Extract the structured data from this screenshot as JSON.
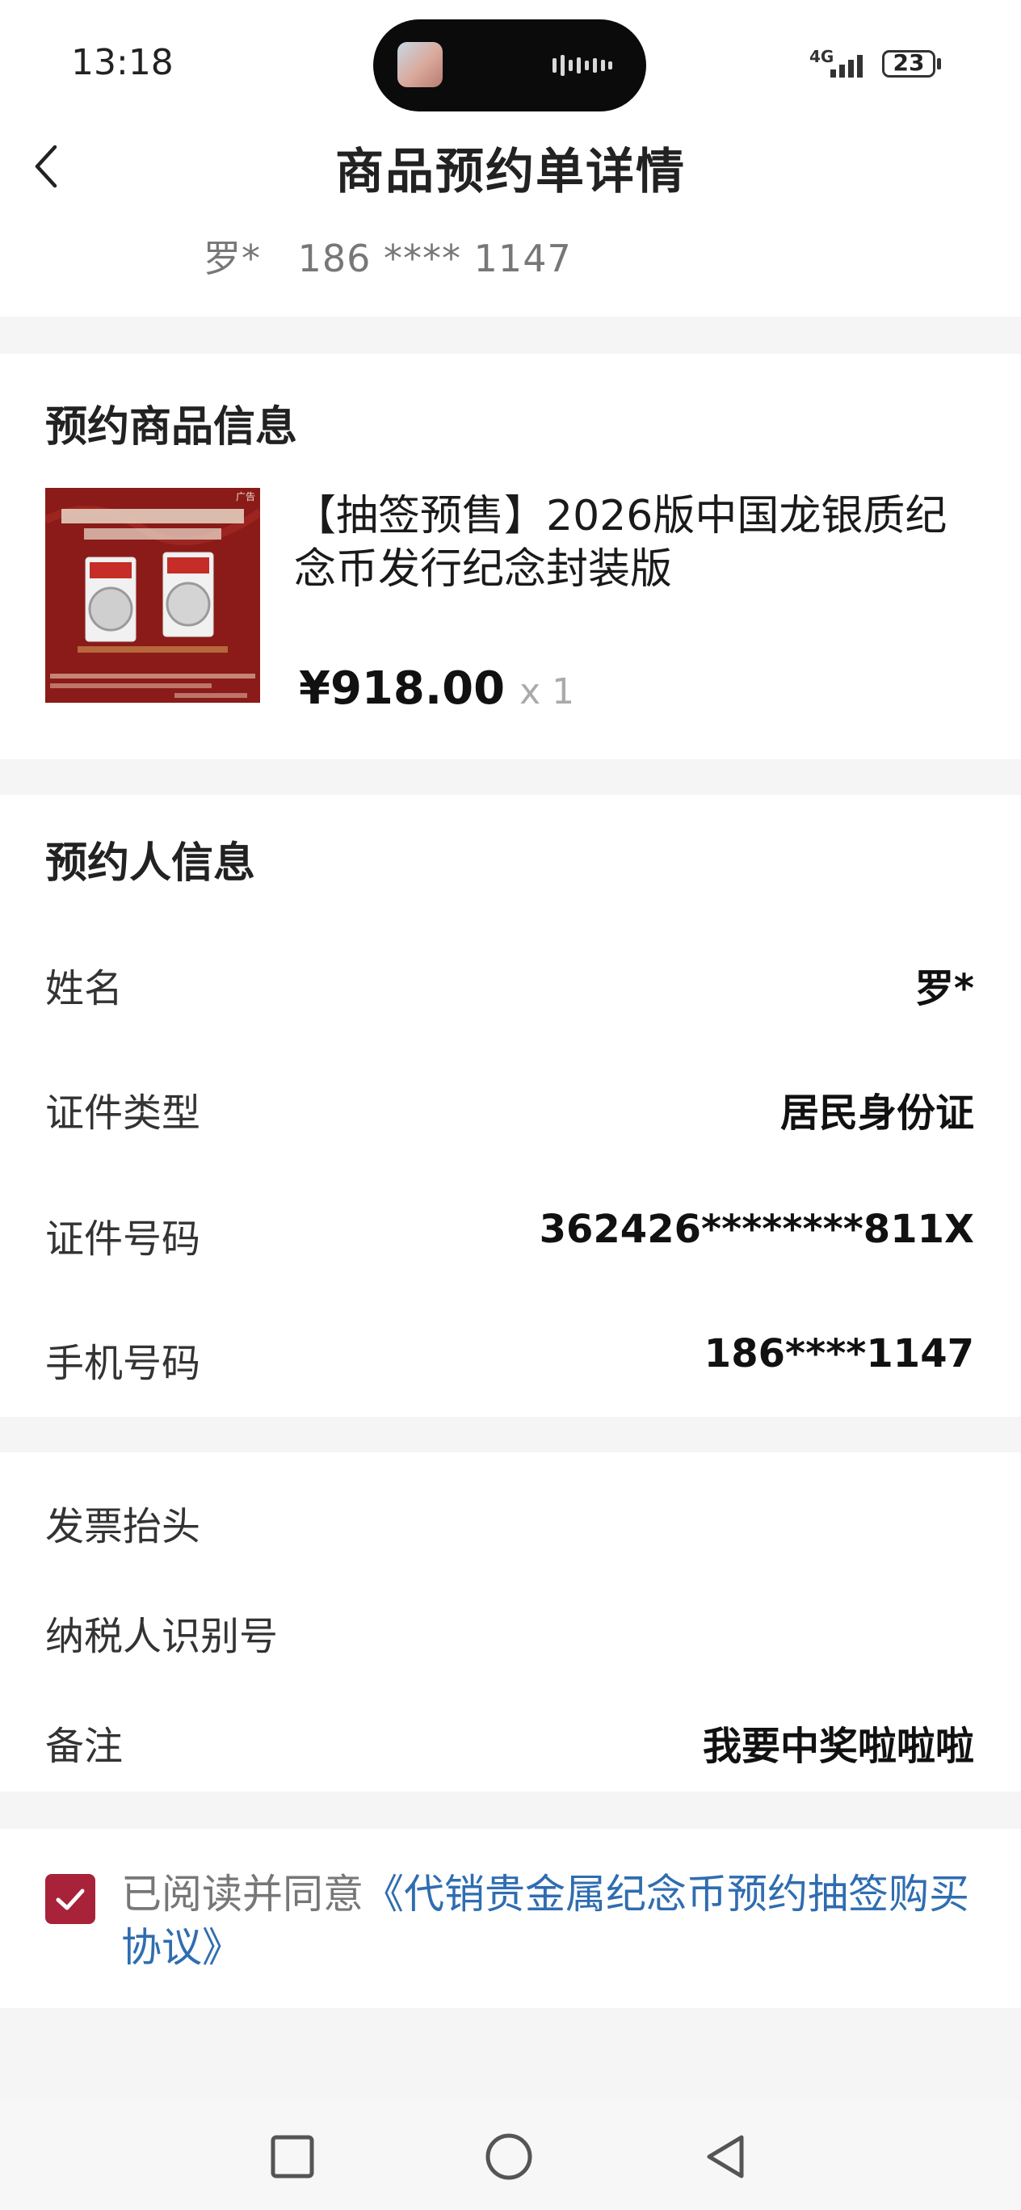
{
  "status_bar": {
    "time": "13:18",
    "network": "4G",
    "battery": "23"
  },
  "header": {
    "title": "商品预约单详情",
    "contact_name": "罗*",
    "contact_phone": "186 **** 1147"
  },
  "product_section": {
    "title": "预约商品信息",
    "product_name": "【抽签预售】2026版中国龙银质纪念币发行纪念封装版",
    "price": "¥918.00",
    "quantity": "x 1",
    "image_tag": "广告"
  },
  "reserver_section": {
    "title": "预约人信息",
    "rows": [
      {
        "label": "姓名",
        "value": "罗*"
      },
      {
        "label": "证件类型",
        "value": "居民身份证"
      },
      {
        "label": "证件号码",
        "value": "362426********811X"
      },
      {
        "label": "手机号码",
        "value": "186****1147"
      }
    ]
  },
  "invoice_section": {
    "rows": [
      {
        "label": "发票抬头",
        "value": ""
      },
      {
        "label": "纳税人识别号",
        "value": ""
      },
      {
        "label": "备注",
        "value": "我要中奖啦啦啦"
      }
    ]
  },
  "agreement": {
    "checked": true,
    "prefix": "已阅读并同意",
    "link": "《代销贵金属纪念币预约抽签购买协议》"
  },
  "nav_bar": {
    "icons": [
      "recent-apps-icon",
      "home-icon",
      "back-nav-icon"
    ]
  },
  "colors": {
    "accent": "#a8223a",
    "link": "#2f6db0",
    "background": "#f5f5f5"
  }
}
